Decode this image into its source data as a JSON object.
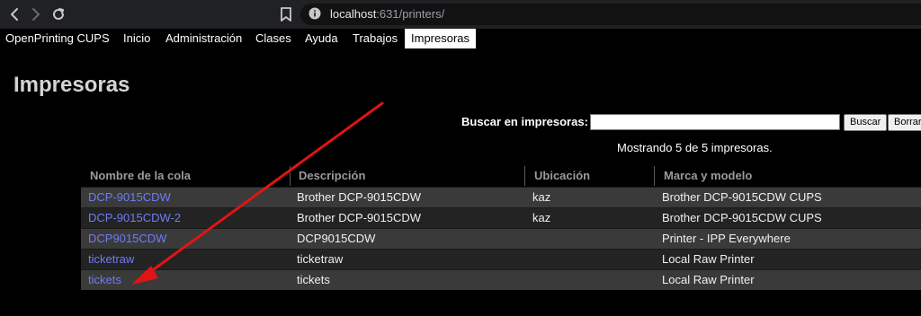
{
  "browser": {
    "url_host": "localhost",
    "url_path": ":631/printers/"
  },
  "menu": {
    "items": [
      "OpenPrinting CUPS",
      "Inicio",
      "Administración",
      "Clases",
      "Ayuda",
      "Trabajos",
      "Impresoras"
    ],
    "active": "Impresoras"
  },
  "page": {
    "title": "Impresoras",
    "search_label": "Buscar en impresoras:",
    "search_value": "",
    "search_button": "Buscar",
    "clear_button": "Borrar",
    "count_text": "Mostrando 5 de 5 impresoras."
  },
  "table": {
    "headers": [
      "Nombre de la cola",
      "Descripción",
      "Ubicación",
      "Marca y modelo"
    ],
    "rows": [
      {
        "name": "DCP-9015CDW",
        "description": "Brother DCP-9015CDW",
        "location": "kaz",
        "model": "Brother DCP-9015CDW CUPS"
      },
      {
        "name": "DCP-9015CDW-2",
        "description": "Brother DCP-9015CDW",
        "location": "kaz",
        "model": "Brother DCP-9015CDW CUPS"
      },
      {
        "name": "DCP9015CDW",
        "description": "DCP9015CDW",
        "location": "",
        "model": "Printer - IPP Everywhere"
      },
      {
        "name": "ticketraw",
        "description": "ticketraw",
        "location": "",
        "model": "Local Raw Printer"
      },
      {
        "name": "tickets",
        "description": "tickets",
        "location": "",
        "model": "Local Raw Printer"
      }
    ]
  },
  "annotation": {
    "color": "#e01414"
  },
  "colors": {
    "link": "#6f7cf7",
    "row_odd": "#3a3a3a",
    "row_even": "#232323",
    "header_text": "#9a9a9a"
  }
}
